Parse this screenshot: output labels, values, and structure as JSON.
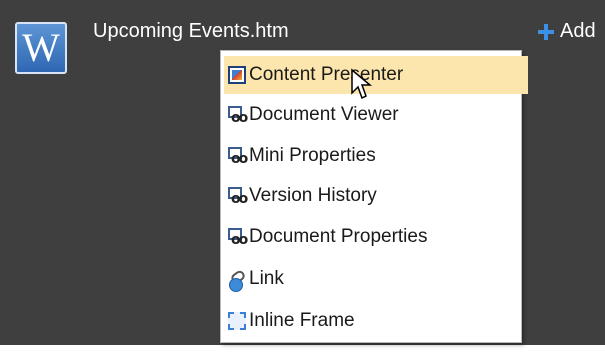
{
  "document": {
    "icon_letter": "W",
    "title": "Upcoming Events.htm"
  },
  "toolbar": {
    "add_label": "Add"
  },
  "menu": {
    "items": [
      {
        "label": "Content Presenter",
        "icon": "content-presenter-icon",
        "highlighted": true
      },
      {
        "label": "Document Viewer",
        "icon": "web-part-icon",
        "highlighted": false
      },
      {
        "label": "Mini Properties",
        "icon": "web-part-icon",
        "highlighted": false
      },
      {
        "label": "Version History",
        "icon": "web-part-icon",
        "highlighted": false
      },
      {
        "label": "Document Properties",
        "icon": "web-part-icon",
        "highlighted": false
      },
      {
        "label": "Link",
        "icon": "link-icon",
        "highlighted": false
      },
      {
        "label": "Inline Frame",
        "icon": "inline-frame-icon",
        "highlighted": false
      }
    ]
  },
  "colors": {
    "panel_background": "#3f3f3f",
    "menu_highlight": "#fde6ad",
    "accent_blue": "#3c91e6"
  }
}
